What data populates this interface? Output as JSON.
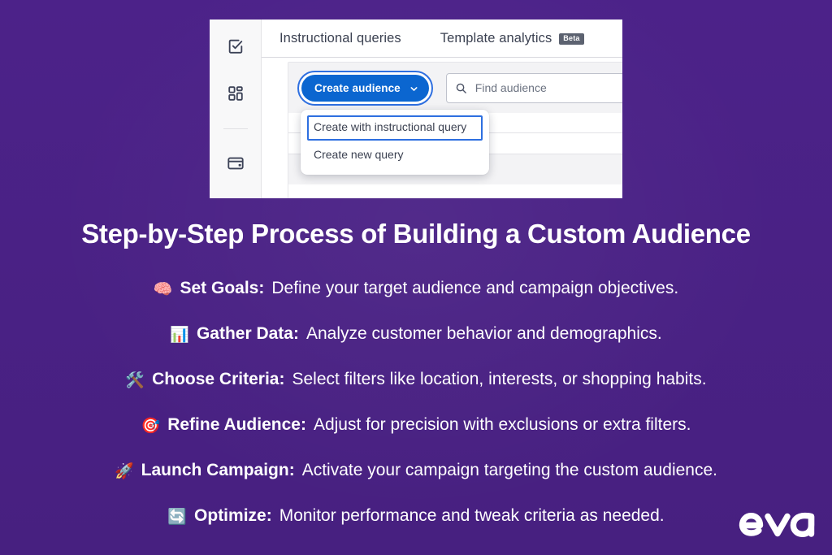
{
  "theme": {
    "background_purple": "#4A2186",
    "accent_blue": "#0B66D0",
    "focus_blue": "#2E6FE0",
    "text_white": "#FFFFFF",
    "panel_white": "#FFFFFF"
  },
  "screenshot": {
    "sidebar": {
      "items": [
        {
          "icon": "task-check-icon"
        },
        {
          "icon": "grid-dashboard-icon"
        },
        {
          "icon": "card-icon"
        }
      ]
    },
    "tabs": [
      {
        "label": "Instructional queries",
        "badge": null
      },
      {
        "label": "Template analytics",
        "badge": "Beta"
      }
    ],
    "toolbar": {
      "create_button_label": "Create audience",
      "create_button_icon": "chevron-down-icon",
      "search_icon": "search-icon",
      "search_placeholder": "Find audience",
      "search_value": ""
    },
    "dropdown": {
      "items": [
        {
          "label": "Create with instructional query",
          "selected": true
        },
        {
          "label": "Create new query",
          "selected": false
        }
      ]
    }
  },
  "headline": "Step-by-Step Process of Building a Custom Audience",
  "steps": [
    {
      "emoji": "🧠",
      "emoji_name": "brain-emoji",
      "label": "Set Goals:",
      "description": "Define your target audience and campaign objectives."
    },
    {
      "emoji": "📊",
      "emoji_name": "bar-chart-emoji",
      "label": "Gather Data:",
      "description": "Analyze customer behavior and demographics."
    },
    {
      "emoji": "🛠️",
      "emoji_name": "hammer-and-wrench-emoji",
      "label": "Choose Criteria:",
      "description": "Select filters like location, interests, or shopping habits."
    },
    {
      "emoji": "🎯",
      "emoji_name": "direct-hit-emoji",
      "label": "Refine Audience:",
      "description": "Adjust for precision with exclusions or extra filters."
    },
    {
      "emoji": "🚀",
      "emoji_name": "rocket-emoji",
      "label": "Launch Campaign:",
      "description": "Activate your campaign targeting the custom audience."
    },
    {
      "emoji": "🔄",
      "emoji_name": "counterclockwise-arrows-emoji",
      "label": "Optimize:",
      "description": "Monitor performance and tweak criteria as needed."
    }
  ],
  "logo": {
    "text": "eva"
  }
}
